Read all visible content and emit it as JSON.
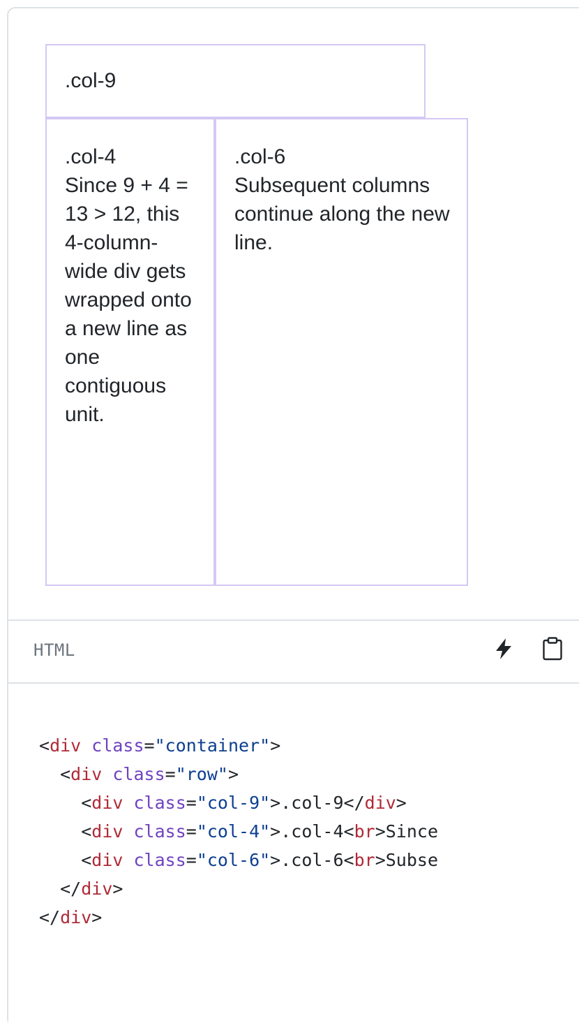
{
  "example": {
    "col9": {
      "text": ".col-9"
    },
    "col4": {
      "title": ".col-4",
      "body": "Since 9 + 4 = 13 > 12, this 4-column-wide div gets wrapped onto a new line as one contiguous unit."
    },
    "col6": {
      "title": ".col-6",
      "body": "Subsequent columns continue along the new line."
    }
  },
  "toolbar": {
    "language": "HTML",
    "bolt_icon": "lightning-bolt-icon",
    "copy_icon": "clipboard-icon"
  },
  "code": {
    "lines": [
      [
        [
          "pu",
          "<"
        ],
        [
          "tg",
          "div"
        ],
        [
          "pu",
          " "
        ],
        [
          "at",
          "class"
        ],
        [
          "pu",
          "="
        ],
        [
          "st",
          "\"container\""
        ],
        [
          "pu",
          ">"
        ]
      ],
      [
        [
          "pu",
          "  <"
        ],
        [
          "tg",
          "div"
        ],
        [
          "pu",
          " "
        ],
        [
          "at",
          "class"
        ],
        [
          "pu",
          "="
        ],
        [
          "st",
          "\"row\""
        ],
        [
          "pu",
          ">"
        ]
      ],
      [
        [
          "pu",
          "    <"
        ],
        [
          "tg",
          "div"
        ],
        [
          "pu",
          " "
        ],
        [
          "at",
          "class"
        ],
        [
          "pu",
          "="
        ],
        [
          "st",
          "\"col-9\""
        ],
        [
          "pu",
          ">.col-9</"
        ],
        [
          "tg",
          "div"
        ],
        [
          "pu",
          ">"
        ]
      ],
      [
        [
          "pu",
          "    <"
        ],
        [
          "tg",
          "div"
        ],
        [
          "pu",
          " "
        ],
        [
          "at",
          "class"
        ],
        [
          "pu",
          "="
        ],
        [
          "st",
          "\"col-4\""
        ],
        [
          "pu",
          ">.col-4<"
        ],
        [
          "tg",
          "br"
        ],
        [
          "pu",
          ">Since"
        ]
      ],
      [
        [
          "pu",
          "    <"
        ],
        [
          "tg",
          "div"
        ],
        [
          "pu",
          " "
        ],
        [
          "at",
          "class"
        ],
        [
          "pu",
          "="
        ],
        [
          "st",
          "\"col-6\""
        ],
        [
          "pu",
          ">.col-6<"
        ],
        [
          "tg",
          "br"
        ],
        [
          "pu",
          ">Subse"
        ]
      ],
      [
        [
          "pu",
          "  </"
        ],
        [
          "tg",
          "div"
        ],
        [
          "pu",
          ">"
        ]
      ],
      [
        [
          "pu",
          "</"
        ],
        [
          "tg",
          "div"
        ],
        [
          "pu",
          ">"
        ]
      ]
    ]
  },
  "colors": {
    "column_border": "#d4c8f4",
    "card_border": "#dee2e6",
    "tag": "#b02a37",
    "attribute": "#6f42c1",
    "string": "#0d3f8f"
  }
}
